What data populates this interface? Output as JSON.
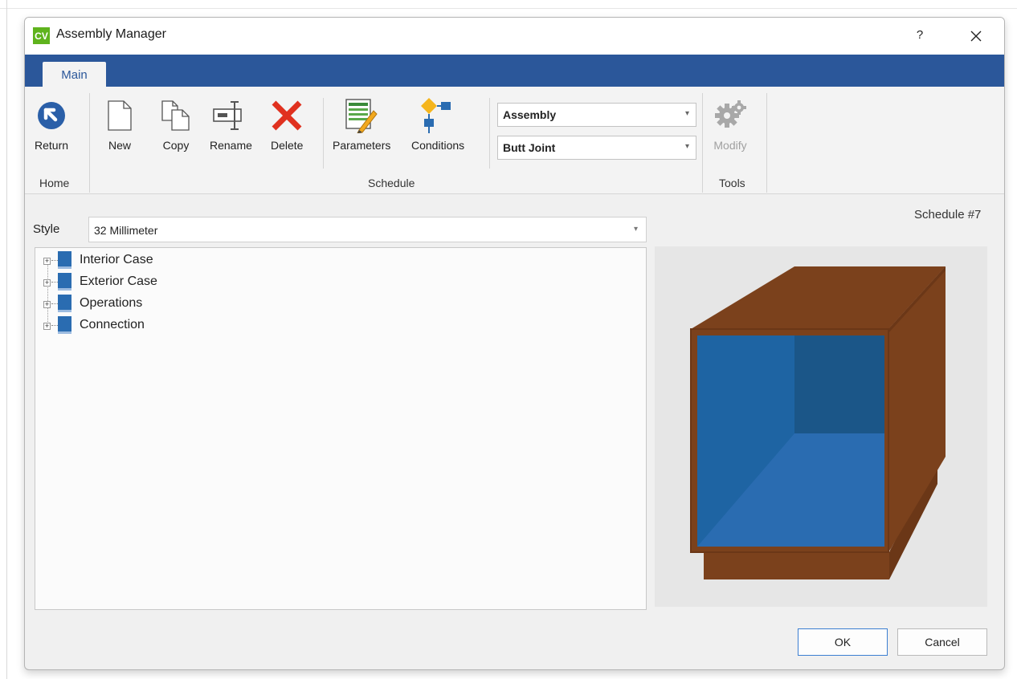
{
  "window": {
    "logo_text": "CV",
    "title": "Assembly Manager",
    "help_label": "?"
  },
  "ribbon": {
    "tabs": [
      {
        "label": "Main",
        "active": true
      }
    ],
    "buttons": {
      "return": "Return",
      "new": "New",
      "copy": "Copy",
      "rename": "Rename",
      "delete": "Delete",
      "parameters": "Parameters",
      "conditions": "Conditions",
      "modify": "Modify"
    },
    "groups": {
      "home": "Home",
      "schedule": "Schedule",
      "tools": "Tools"
    },
    "selects": {
      "type_value": "Assembly",
      "joint_value": "Butt Joint"
    }
  },
  "main": {
    "style_label": "Style",
    "style_value": "32 Millimeter",
    "schedule_label": "Schedule #7",
    "tree_items": [
      "Interior Case",
      "Exterior Case",
      "Operations",
      "Connection"
    ]
  },
  "footer": {
    "ok_label": "OK",
    "cancel_label": "Cancel"
  },
  "colors": {
    "ribbon_blue": "#2b579a",
    "logo_green": "#5fb31d",
    "delete_red": "#e0311f",
    "cabinet_wood": "#7b411c",
    "cabinet_interior": "#2a6cb1"
  }
}
